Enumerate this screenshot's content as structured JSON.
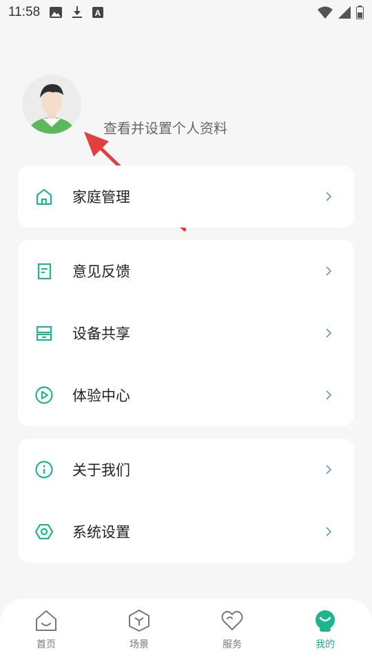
{
  "status_bar": {
    "time": "11:58"
  },
  "profile": {
    "subtitle": "查看并设置个人资料"
  },
  "colors": {
    "accent": "#1eb48c",
    "arrow": "#e04040",
    "chevron": "#6a8fd8"
  },
  "menu": {
    "card1": [
      {
        "label": "家庭管理",
        "icon": "home-icon"
      }
    ],
    "card2": [
      {
        "label": "意见反馈",
        "icon": "feedback-icon"
      },
      {
        "label": "设备共享",
        "icon": "device-share-icon"
      },
      {
        "label": "体验中心",
        "icon": "play-circle-icon"
      }
    ],
    "card3": [
      {
        "label": "关于我们",
        "icon": "info-icon"
      },
      {
        "label": "系统设置",
        "icon": "settings-icon"
      }
    ]
  },
  "bottom_nav": {
    "items": [
      {
        "label": "首页",
        "icon": "home-nav-icon",
        "active": false
      },
      {
        "label": "场景",
        "icon": "scene-cube-icon",
        "active": false
      },
      {
        "label": "服务",
        "icon": "heart-icon",
        "active": false
      },
      {
        "label": "我的",
        "icon": "mine-face-icon",
        "active": true
      }
    ]
  }
}
